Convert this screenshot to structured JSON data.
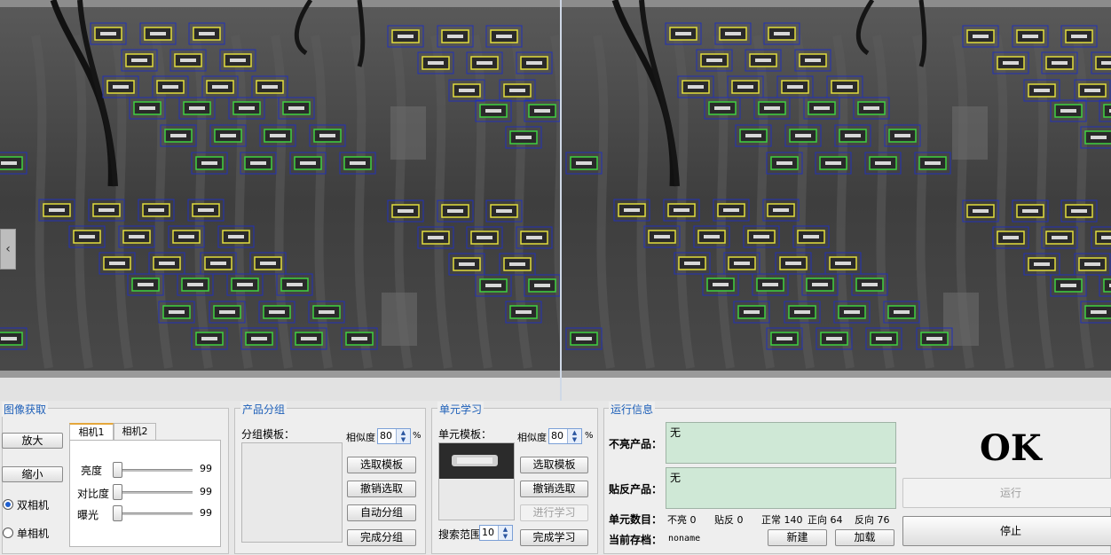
{
  "colors": {
    "normal_box": "#3fd140",
    "reverse_box": "#e2dd3c",
    "outer_box": "#2231b8",
    "panel_title": "#1d5fb8",
    "text_area": "#cfe8d6"
  },
  "cameras": {
    "left_label": "",
    "right_label": ""
  },
  "nav": {
    "left_arrow_glyph": "‹"
  },
  "acquire": {
    "title": "图像获取",
    "zoom_in": "放大",
    "zoom_out": "缩小",
    "dual_camera": "双相机",
    "single_camera": "单相机",
    "tabs": [
      "相机1",
      "相机2"
    ],
    "brightness_label": "亮度",
    "brightness_value": "99",
    "contrast_label": "对比度",
    "contrast_value": "99",
    "exposure_label": "曝光",
    "exposure_value": "99"
  },
  "product_group": {
    "title": "产品分组",
    "template_label": "分组模板：",
    "similarity_label": "相似度",
    "similarity_value": "80",
    "percent": "%",
    "select_template": "选取模板",
    "undo_select": "撤销选取",
    "auto_group": "自动分组",
    "finish_group": "完成分组"
  },
  "unit_learn": {
    "title": "单元学习",
    "template_label": "单元模板：",
    "similarity_label": "相似度",
    "similarity_value": "80",
    "percent": "%",
    "select_template": "选取模板",
    "undo_select": "撤销选取",
    "learning": "进行学习",
    "finish_learning": "完成学习",
    "search_range_label": "搜索范围",
    "search_range_value": "10"
  },
  "run_info": {
    "title": "运行信息",
    "not_lit_label": "不亮产品：",
    "not_lit_value": "无",
    "reversed_label": "贴反产品：",
    "reversed_value": "无",
    "unit_count_label": "单元数目：",
    "not_lit_count": "不亮 0",
    "reversed_count": "贴反 0",
    "normal_count": "正常 140",
    "forward_count": "正向 64",
    "backward_count": "反向 76",
    "current_archive_label": "当前存档：",
    "current_archive_value": "noname",
    "new_button": "新建",
    "load_button": "加载",
    "status": "OK",
    "run_button": "运行",
    "stop_button": "停止"
  }
}
